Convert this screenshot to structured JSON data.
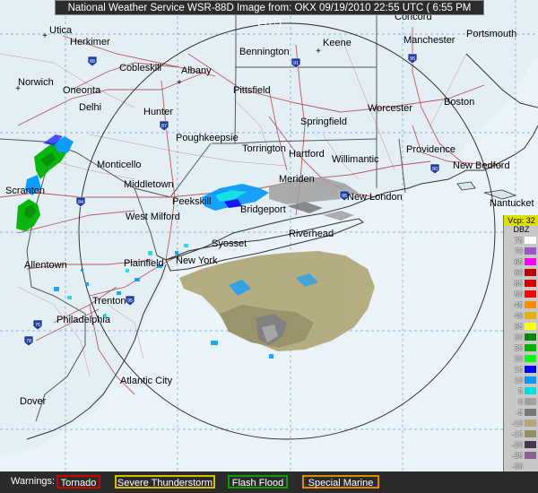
{
  "title": "National Weather Service WSR-88D Image from: OKX 09/19/2010  22:55 UTC  ( 6:55 PM EDT)",
  "legend": {
    "header": "Vcp: 32",
    "unit": "DBZ",
    "levels": [
      {
        "label": "75",
        "color": "#ffffff"
      },
      {
        "label": "70",
        "color": "#9955cc"
      },
      {
        "label": "65",
        "color": "#ff00ff"
      },
      {
        "label": "60",
        "color": "#c00000"
      },
      {
        "label": "55",
        "color": "#d40000"
      },
      {
        "label": "50",
        "color": "#ff0000"
      },
      {
        "label": "45",
        "color": "#ff8c00"
      },
      {
        "label": "40",
        "color": "#e8b000"
      },
      {
        "label": "35",
        "color": "#ffff00"
      },
      {
        "label": "30",
        "color": "#008c00"
      },
      {
        "label": "25",
        "color": "#00b400"
      },
      {
        "label": "20",
        "color": "#00ff00"
      },
      {
        "label": "15",
        "color": "#0000ff"
      },
      {
        "label": "10",
        "color": "#0099ff"
      },
      {
        "label": "5",
        "color": "#00e0e0"
      },
      {
        "label": "0",
        "color": "#a0a0a0"
      },
      {
        "label": "-5",
        "color": "#787878"
      },
      {
        "label": "-10",
        "color": "#b0a878"
      },
      {
        "label": "-15",
        "color": "#958c60"
      },
      {
        "label": "-20",
        "color": "#503050"
      },
      {
        "label": "-25",
        "color": "#8c6090"
      },
      {
        "label": "-30",
        "color": "#c8c8c8"
      },
      {
        "label": "ND",
        "color": "#1a1a1a"
      }
    ]
  },
  "warnings": {
    "label": "Warnings:",
    "tornado": {
      "label": "Tornado",
      "color": "#cc0000"
    },
    "severe": {
      "label": "Severe Thunderstorm",
      "color": "#d4c000"
    },
    "flood": {
      "label": "Flash Flood",
      "color": "#00a000"
    },
    "marine": {
      "label": "Special Marine",
      "color": "#e08800"
    }
  },
  "highways": [
    "88",
    "87",
    "91",
    "95",
    "84",
    "80",
    "78",
    "76",
    "95",
    "95",
    "90"
  ],
  "cities": [
    {
      "name": "Utica"
    },
    {
      "name": "Herkimer"
    },
    {
      "name": "Cobleskill"
    },
    {
      "name": "Albany"
    },
    {
      "name": "Bennington"
    },
    {
      "name": "Keene"
    },
    {
      "name": "Concord"
    },
    {
      "name": "Manchester"
    },
    {
      "name": "Portsmouth"
    },
    {
      "name": "Norwich"
    },
    {
      "name": "Oneonta"
    },
    {
      "name": "Delhi"
    },
    {
      "name": "Hunter"
    },
    {
      "name": "Pittsfield"
    },
    {
      "name": "Springfield"
    },
    {
      "name": "Worcester"
    },
    {
      "name": "Boston"
    },
    {
      "name": "Monticello"
    },
    {
      "name": "Poughkeepsie"
    },
    {
      "name": "Torrington"
    },
    {
      "name": "Hartford"
    },
    {
      "name": "Willimantic"
    },
    {
      "name": "Providence"
    },
    {
      "name": "New Bedford"
    },
    {
      "name": "Scranton"
    },
    {
      "name": "Middletown"
    },
    {
      "name": "Peekskill"
    },
    {
      "name": "Meriden"
    },
    {
      "name": "New London"
    },
    {
      "name": "Nantucket"
    },
    {
      "name": "West Milford"
    },
    {
      "name": "Bridgeport"
    },
    {
      "name": "Riverhead"
    },
    {
      "name": "Syosset"
    },
    {
      "name": "Allentown"
    },
    {
      "name": "Plainfield"
    },
    {
      "name": "New York"
    },
    {
      "name": "Trenton"
    },
    {
      "name": "Philadelphia"
    },
    {
      "name": "Atlantic City"
    },
    {
      "name": "Dover"
    }
  ]
}
